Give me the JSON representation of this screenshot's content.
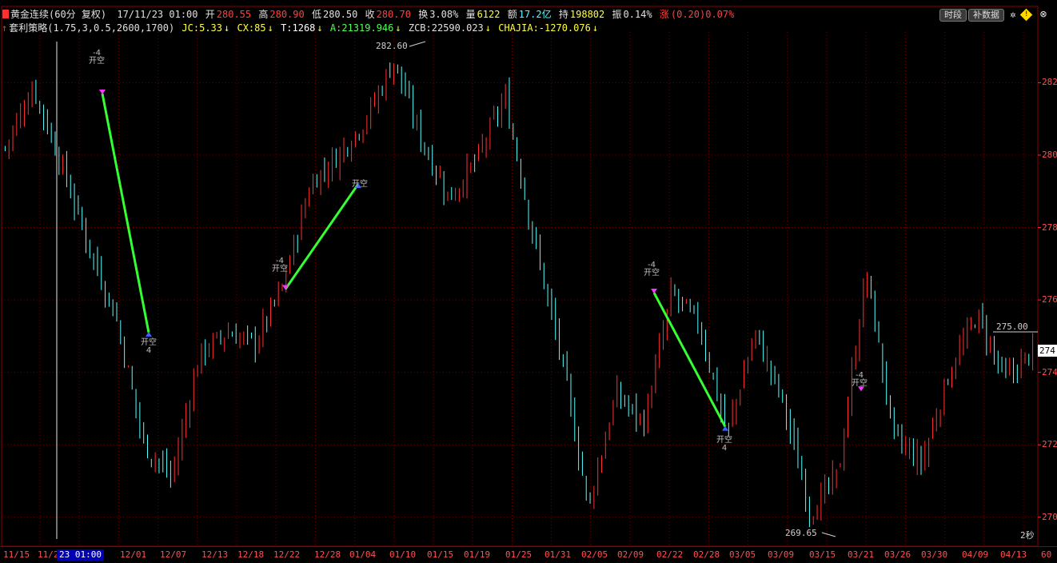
{
  "header": {
    "symbol": "黄金连续(60分 复权)",
    "datetime": "17/11/23 01:00",
    "open_label": "开",
    "open": "280.55",
    "high_label": "高",
    "high": "280.90",
    "low_label": "低",
    "low": "280.50",
    "close_label": "收",
    "close": "280.70",
    "turnover_label": "换",
    "turnover": "3.08%",
    "volume_label": "量",
    "volume": "6122",
    "amount_label": "额",
    "amount": "17.2亿",
    "hold_label": "持",
    "hold": "198802",
    "amplitude_label": "振",
    "amplitude": "0.14%",
    "change_label": "涨",
    "change": "(0.20)0.07%"
  },
  "indicator": {
    "name": "套利策略(1.75,3,0.5,2600,1700)",
    "jc": "JC:5.33",
    "cx": "CX:85",
    "t": "T:1268",
    "a": "A:21319.946",
    "zcb": "ZCB:22590.023",
    "chajia": "CHAJIA:-1270.076"
  },
  "toolbar": {
    "period_button": "时段",
    "supplement_button": "补数据"
  },
  "colors": {
    "up": "#ff3030",
    "down": "#54ffff",
    "trade_line": "#33ff33",
    "signal_marker": "#ff33ff",
    "grid": "#6a0000"
  },
  "y_axis": {
    "labels": [
      "282",
      "280",
      "278",
      "276",
      "274",
      "272",
      "270"
    ],
    "values": [
      282,
      280,
      278,
      276,
      274,
      272,
      270
    ]
  },
  "x_axis": {
    "labels": [
      "11/15",
      "11/2",
      "12/01",
      "12/07",
      "12/13",
      "12/18",
      "12/22",
      "12/28",
      "01/04",
      "01/10",
      "01/15",
      "01/19",
      "01/25",
      "01/31",
      "02/05",
      "02/09",
      "02/22",
      "02/28",
      "03/05",
      "03/09",
      "03/15",
      "03/21",
      "03/26",
      "03/30",
      "04/09",
      "04/13",
      "60"
    ],
    "cursor_label": "23 01:00"
  },
  "annotations": {
    "max_price": "282.60",
    "min_price": "269.65",
    "price_line": "275.00",
    "last_price_box": "274",
    "refresh": "2秒"
  },
  "signals": [
    {
      "top": "-4",
      "bottom": "开空"
    },
    {
      "top": "开空",
      "bottom": "4"
    },
    {
      "top": "-4",
      "bottom": "开空"
    },
    {
      "top": "开空",
      "bottom": ""
    },
    {
      "top": "-4",
      "bottom": "开空"
    },
    {
      "top": "开空",
      "bottom": "4"
    },
    {
      "top": "-4",
      "bottom": "开空"
    }
  ],
  "chart_data": {
    "type": "candlestick",
    "ylim": [
      269.2,
      283.4
    ],
    "trades": [
      {
        "from_price": 281.7,
        "to_price": 275.1
      },
      {
        "from_price": 276.3,
        "to_price": 279.2
      },
      {
        "from_price": 276.2,
        "to_price": 272.5
      }
    ],
    "path_key_prices": [
      280.2,
      281.9,
      279.8,
      277.5,
      275.5,
      272.0,
      271.1,
      274.5,
      275.1,
      274.8,
      276.4,
      279.2,
      280.0,
      281.0,
      282.6,
      280.4,
      278.8,
      279.9,
      281.6,
      277.8,
      274.5,
      270.3,
      273.4,
      272.6,
      276.2,
      275.3,
      272.3,
      275.1,
      273.2,
      270.1,
      271.2,
      276.8,
      272.2,
      271.5,
      274.0,
      275.6,
      273.8,
      274.6
    ]
  }
}
